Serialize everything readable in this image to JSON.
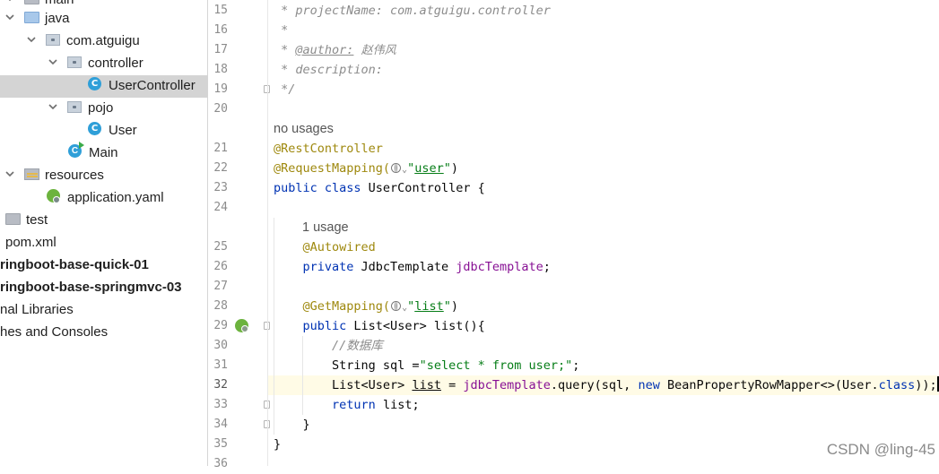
{
  "project_tree": {
    "items": [
      {
        "label": "main",
        "icon": "folder-icon",
        "indent": 1,
        "arrow": "down",
        "selected": false,
        "bold": false
      },
      {
        "label": "java",
        "icon": "source-folder-icon",
        "indent": 1,
        "arrow": "down",
        "selected": false,
        "bold": false
      },
      {
        "label": "com.atguigu",
        "icon": "package-icon",
        "indent": 2,
        "arrow": "down",
        "selected": false,
        "bold": false
      },
      {
        "label": "controller",
        "icon": "package-icon",
        "indent": 3,
        "arrow": "down",
        "selected": false,
        "bold": false
      },
      {
        "label": "UserController",
        "icon": "class-icon",
        "indent": 4,
        "arrow": "none",
        "selected": true,
        "bold": false
      },
      {
        "label": "pojo",
        "icon": "package-icon",
        "indent": 3,
        "arrow": "down",
        "selected": false,
        "bold": false
      },
      {
        "label": "User",
        "icon": "class-icon",
        "indent": 4,
        "arrow": "none",
        "selected": false,
        "bold": false
      },
      {
        "label": "Main",
        "icon": "main-class-icon",
        "indent": 3,
        "arrow": "none",
        "selected": false,
        "bold": false
      },
      {
        "label": "resources",
        "icon": "resources-folder-icon",
        "indent": 1,
        "arrow": "down",
        "selected": false,
        "bold": false
      },
      {
        "label": "application.yaml",
        "icon": "spring-yaml-icon",
        "indent": 2,
        "arrow": "none",
        "selected": false,
        "bold": false
      },
      {
        "label": "test",
        "icon": "folder-icon",
        "indent": 0,
        "arrow": "none",
        "selected": false,
        "bold": false
      },
      {
        "label": "pom.xml",
        "icon": "none",
        "indent": 0,
        "arrow": "none",
        "selected": false,
        "bold": false
      },
      {
        "label": "ringboot-base-quick-01",
        "icon": "none",
        "indent": 0,
        "arrow": "none",
        "selected": false,
        "bold": true
      },
      {
        "label": "ringboot-base-springmvc-03",
        "icon": "none",
        "indent": 0,
        "arrow": "none",
        "selected": false,
        "bold": true
      },
      {
        "label": "nal Libraries",
        "icon": "none",
        "indent": 0,
        "arrow": "none",
        "selected": false,
        "bold": false
      },
      {
        "label": "hes and Consoles",
        "icon": "none",
        "indent": 0,
        "arrow": "none",
        "selected": false,
        "bold": false
      }
    ]
  },
  "editor": {
    "current_line": "32",
    "lines": [
      {
        "no": "15",
        "tokens": [
          {
            "t": " * projectName: com.atguigu.controller",
            "c": "cmt"
          }
        ]
      },
      {
        "no": "16",
        "tokens": [
          {
            "t": " *",
            "c": "cmt"
          }
        ]
      },
      {
        "no": "17",
        "tokens": [
          {
            "t": " * ",
            "c": "cmt"
          },
          {
            "t": "@author:",
            "c": "tag"
          },
          {
            "t": " ",
            "c": "cmt"
          },
          {
            "t": "赵伟风",
            "c": "cn"
          }
        ]
      },
      {
        "no": "18",
        "tokens": [
          {
            "t": " * description:",
            "c": "cmt"
          }
        ]
      },
      {
        "no": "19",
        "tokens": [
          {
            "t": " */",
            "c": "cmt"
          }
        ]
      },
      {
        "no": "20",
        "tokens": []
      },
      {
        "no": "",
        "hint": "no usages",
        "indent": 0
      },
      {
        "no": "21",
        "tokens": [
          {
            "t": "@RestController",
            "c": "ann"
          }
        ]
      },
      {
        "no": "22",
        "tokens": [
          {
            "t": "@RequestMapping(",
            "c": "ann"
          },
          {
            "t": "",
            "c": "globe"
          },
          {
            "t": "\"",
            "c": "str"
          },
          {
            "t": "user",
            "c": "str und"
          },
          {
            "t": "\"",
            "c": "str"
          },
          {
            "t": ")",
            "c": ""
          }
        ]
      },
      {
        "no": "23",
        "tokens": [
          {
            "t": "public class ",
            "c": "kw"
          },
          {
            "t": "UserController {",
            "c": ""
          }
        ]
      },
      {
        "no": "24",
        "tokens": []
      },
      {
        "no": "",
        "hint": "1 usage",
        "indent": 1
      },
      {
        "no": "25",
        "tokens": [
          {
            "t": "    ",
            "c": ""
          },
          {
            "t": "@Autowired",
            "c": "ann"
          }
        ]
      },
      {
        "no": "26",
        "tokens": [
          {
            "t": "    ",
            "c": ""
          },
          {
            "t": "private ",
            "c": "kw"
          },
          {
            "t": "JdbcTemplate ",
            "c": ""
          },
          {
            "t": "jdbcTemplate",
            "c": "fld"
          },
          {
            "t": ";",
            "c": ""
          }
        ]
      },
      {
        "no": "27",
        "tokens": []
      },
      {
        "no": "28",
        "tokens": [
          {
            "t": "    ",
            "c": ""
          },
          {
            "t": "@GetMapping(",
            "c": "ann"
          },
          {
            "t": "",
            "c": "globe"
          },
          {
            "t": "\"",
            "c": "str"
          },
          {
            "t": "list",
            "c": "str und"
          },
          {
            "t": "\"",
            "c": "str"
          },
          {
            "t": ")",
            "c": ""
          }
        ]
      },
      {
        "no": "29",
        "tokens": [
          {
            "t": "    ",
            "c": ""
          },
          {
            "t": "public ",
            "c": "kw"
          },
          {
            "t": "List<User> list(){",
            "c": ""
          }
        ]
      },
      {
        "no": "30",
        "tokens": [
          {
            "t": "        ",
            "c": ""
          },
          {
            "t": "//数据库",
            "c": "cmt"
          }
        ]
      },
      {
        "no": "31",
        "tokens": [
          {
            "t": "        String sql =",
            "c": ""
          },
          {
            "t": "\"select * from user;\"",
            "c": "str"
          },
          {
            "t": ";",
            "c": ""
          }
        ]
      },
      {
        "no": "32",
        "tokens": [
          {
            "t": "        List<User> ",
            "c": ""
          },
          {
            "t": "list",
            "c": "und"
          },
          {
            "t": " = ",
            "c": ""
          },
          {
            "t": "jdbcTemplate",
            "c": "fld"
          },
          {
            "t": ".query(sql, ",
            "c": ""
          },
          {
            "t": "new ",
            "c": "kw"
          },
          {
            "t": "BeanPropertyRowMapper<>(User.",
            "c": ""
          },
          {
            "t": "class",
            "c": "kw"
          },
          {
            "t": "));",
            "c": ""
          },
          {
            "t": "",
            "c": "caret"
          }
        ]
      },
      {
        "no": "33",
        "tokens": [
          {
            "t": "        ",
            "c": ""
          },
          {
            "t": "return ",
            "c": "kw"
          },
          {
            "t": "list;",
            "c": ""
          }
        ]
      },
      {
        "no": "34",
        "tokens": [
          {
            "t": "    }",
            "c": ""
          }
        ]
      },
      {
        "no": "35",
        "tokens": [
          {
            "t": "}",
            "c": ""
          }
        ]
      },
      {
        "no": "36",
        "tokens": []
      }
    ]
  },
  "watermark": "CSDN @ling-45",
  "colors": {
    "keyword": "#0033b3",
    "string": "#067d17",
    "annotation": "#9e880d",
    "field": "#871094",
    "comment": "#8c8c8c",
    "selection": "#d4d4d4",
    "current_line_bg": "#fffbe6"
  }
}
